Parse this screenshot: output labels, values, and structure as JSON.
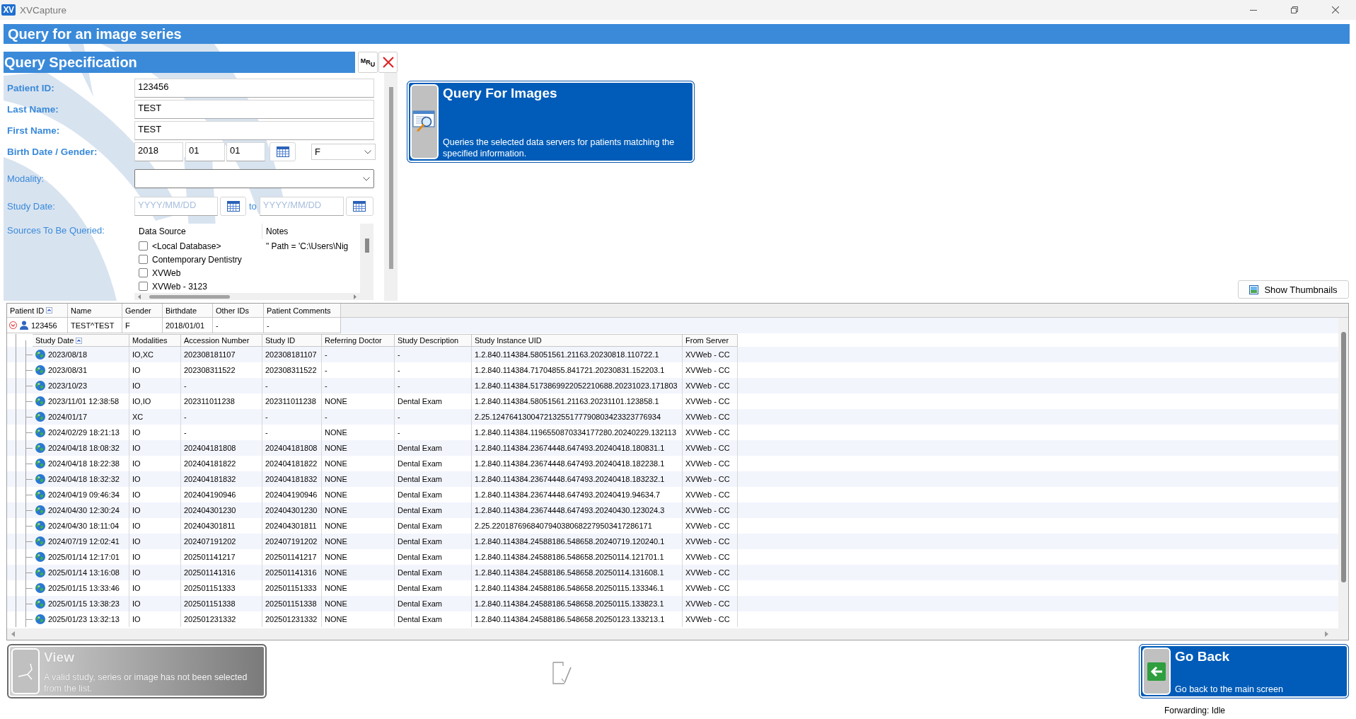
{
  "window": {
    "title": "XVCapture",
    "icon_text": "XV"
  },
  "page_header": {
    "title": "Query for an image series"
  },
  "query_spec": {
    "title": "Query Specification",
    "mru_button": {
      "label": "MRU"
    },
    "fields": [
      {
        "kind": "text",
        "label": "Patient ID:",
        "value": "123456"
      },
      {
        "kind": "text",
        "label": "Last Name:",
        "value": "TEST"
      },
      {
        "kind": "text",
        "label": "First Name:",
        "value": "TEST"
      },
      {
        "kind": "birth_gender",
        "label": "Birth Date / Gender:",
        "year": "2018",
        "month": "01",
        "day": "01",
        "gender": "F"
      },
      {
        "kind": "dropdown",
        "label": "Modality:"
      },
      {
        "kind": "date_range",
        "label": "Study Date:",
        "from_placeholder": "YYYY/MM/DD",
        "separator": "to",
        "to_placeholder": "YYYY/MM/DD"
      },
      {
        "kind": "sources",
        "label": "Sources To Be Queried:",
        "columns": [
          "Data Source",
          "Notes"
        ],
        "rows": [
          {
            "name": "<Local Database>",
            "notes": "\" Path = 'C:\\Users\\Nig",
            "checked": false
          },
          {
            "name": "Contemporary Dentistry",
            "checked": false
          },
          {
            "name": "XVWeb",
            "checked": false
          },
          {
            "name": "XVWeb - 3123",
            "checked": false
          }
        ]
      }
    ]
  },
  "query_button": {
    "title": "Query For Images",
    "description": "Queries the selected data servers for patients matching the specified information."
  },
  "show_thumbnails_button": {
    "label": "Show Thumbnails"
  },
  "patient_table": {
    "columns": [
      {
        "label": "Patient ID",
        "sorted": true
      },
      {
        "label": "Name",
        "sorted": false
      },
      {
        "label": "Gender",
        "sorted": false
      },
      {
        "label": "Birthdate",
        "sorted": false
      },
      {
        "label": "Other IDs",
        "sorted": false
      },
      {
        "label": "Patient Comments",
        "sorted": false
      }
    ],
    "rows": [
      {
        "expanded": true,
        "cells": [
          "123456",
          "TEST^TEST",
          "F",
          "2018/01/01",
          "-",
          "-"
        ],
        "studies": {
          "columns": [
            {
              "label": "Study Date",
              "sorted": true
            },
            {
              "label": "Modalities",
              "sorted": false
            },
            {
              "label": "Accession Number",
              "sorted": false
            },
            {
              "label": "Study ID",
              "sorted": false
            },
            {
              "label": "Referring Doctor",
              "sorted": false
            },
            {
              "label": "Study Description",
              "sorted": false
            },
            {
              "label": "Study Instance UID",
              "sorted": false
            },
            {
              "label": "From Server",
              "sorted": false
            }
          ],
          "rows": [
            [
              "2023/08/18",
              "IO,XC",
              "202308181107",
              "202308181107",
              "-",
              "-",
              "1.2.840.114384.58051561.21163.20230818.110722.1",
              "XVWeb - CC"
            ],
            [
              "2023/08/31",
              "IO",
              "202308311522",
              "202308311522",
              "-",
              "-",
              "1.2.840.114384.71704855.841721.20230831.152203.1",
              "XVWeb - CC"
            ],
            [
              "2023/10/23",
              "IO",
              "-",
              "-",
              "-",
              "-",
              "1.2.840.114384.5173869922052210688.20231023.171803",
              "XVWeb - CC"
            ],
            [
              "2023/11/01 12:38:58",
              "IO,IO",
              "202311011238",
              "202311011238",
              "NONE",
              "Dental Exam",
              "1.2.840.114384.58051561.21163.20231101.123858.1",
              "XVWeb - CC"
            ],
            [
              "2024/01/17",
              "XC",
              "-",
              "-",
              "-",
              "-",
              "2.25.124764130047213255177790803423323776934",
              "XVWeb - CC"
            ],
            [
              "2024/02/29 18:21:13",
              "IO",
              "-",
              "-",
              "NONE",
              "-",
              "1.2.840.114384.1196550870334177280.20240229.132113",
              "XVWeb - CC"
            ],
            [
              "2024/04/18 18:08:32",
              "IO",
              "202404181808",
              "202404181808",
              "NONE",
              "Dental Exam",
              "1.2.840.114384.23674448.647493.20240418.180831.1",
              "XVWeb - CC"
            ],
            [
              "2024/04/18 18:22:38",
              "IO",
              "202404181822",
              "202404181822",
              "NONE",
              "Dental Exam",
              "1.2.840.114384.23674448.647493.20240418.182238.1",
              "XVWeb - CC"
            ],
            [
              "2024/04/18 18:32:32",
              "IO",
              "202404181832",
              "202404181832",
              "NONE",
              "Dental Exam",
              "1.2.840.114384.23674448.647493.20240418.183232.1",
              "XVWeb - CC"
            ],
            [
              "2024/04/19 09:46:34",
              "IO",
              "202404190946",
              "202404190946",
              "NONE",
              "Dental Exam",
              "1.2.840.114384.23674448.647493.20240419.94634.7",
              "XVWeb - CC"
            ],
            [
              "2024/04/30 12:30:24",
              "IO",
              "202404301230",
              "202404301230",
              "NONE",
              "Dental Exam",
              "1.2.840.114384.23674448.647493.20240430.123024.3",
              "XVWeb - CC"
            ],
            [
              "2024/04/30 18:11:04",
              "IO",
              "202404301811",
              "202404301811",
              "NONE",
              "Dental Exam",
              "2.25.2201876968407940380682279503417286171",
              "XVWeb - CC"
            ],
            [
              "2024/07/19 12:02:41",
              "IO",
              "202407191202",
              "202407191202",
              "NONE",
              "Dental Exam",
              "1.2.840.114384.24588186.548658.20240719.120240.1",
              "XVWeb - CC"
            ],
            [
              "2025/01/14 12:17:01",
              "IO",
              "202501141217",
              "202501141217",
              "NONE",
              "Dental Exam",
              "1.2.840.114384.24588186.548658.20250114.121701.1",
              "XVWeb - CC"
            ],
            [
              "2025/01/14 13:16:08",
              "IO",
              "202501141316",
              "202501141316",
              "NONE",
              "Dental Exam",
              "1.2.840.114384.24588186.548658.20250114.131608.1",
              "XVWeb - CC"
            ],
            [
              "2025/01/15 13:33:46",
              "IO",
              "202501151333",
              "202501151333",
              "NONE",
              "Dental Exam",
              "1.2.840.114384.24588186.548658.20250115.133346.1",
              "XVWeb - CC"
            ],
            [
              "2025/01/15 13:38:23",
              "IO",
              "202501151338",
              "202501151338",
              "NONE",
              "Dental Exam",
              "1.2.840.114384.24588186.548658.20250115.133823.1",
              "XVWeb - CC"
            ],
            [
              "2025/01/23 13:32:13",
              "IO",
              "202501231332",
              "202501231332",
              "NONE",
              "Dental Exam",
              "1.2.840.114384.24588186.548658.20250123.133213.1",
              "XVWeb - CC"
            ]
          ]
        }
      }
    ]
  },
  "view_button": {
    "title": "View",
    "description": "A valid study, series or image has not been selected from the list.",
    "disabled": true
  },
  "go_back_button": {
    "title": "Go Back",
    "description": "Go back to the main screen"
  },
  "status_bar": {
    "text": "Forwarding: Idle"
  }
}
